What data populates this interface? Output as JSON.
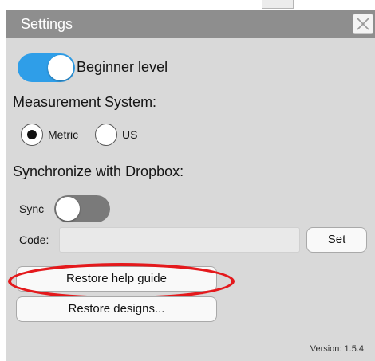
{
  "window": {
    "title": "Settings",
    "close_icon": "close-x-icon"
  },
  "beginner": {
    "label": "Beginner level",
    "enabled": true
  },
  "measurement": {
    "heading": "Measurement System:",
    "options": [
      {
        "label": "Metric",
        "selected": true
      },
      {
        "label": "US",
        "selected": false
      }
    ]
  },
  "dropbox": {
    "heading": "Synchronize with Dropbox:",
    "sync_label": "Sync",
    "sync_enabled": false,
    "code_label": "Code:",
    "code_value": "",
    "set_label": "Set"
  },
  "actions": {
    "restore_help": "Restore help guide",
    "restore_designs": "Restore designs..."
  },
  "version": "Version: 1.5.4",
  "colors": {
    "accent": "#2f9ee8",
    "titlebar": "#8e8e8e",
    "panel": "#d9d9d9",
    "highlight": "#e4191c"
  }
}
